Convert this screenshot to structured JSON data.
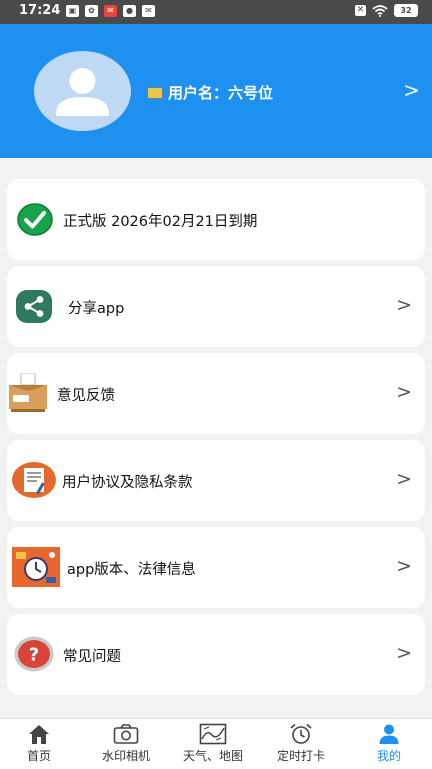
{
  "status_bar": {
    "time": "17:24",
    "battery": "32"
  },
  "profile": {
    "username_label": "用户名：六号位",
    "arrow": ">"
  },
  "menu": [
    {
      "label": "正式版 2026年02月21日到期",
      "icon": "check-circle-icon",
      "chevron": ""
    },
    {
      "label": "分享app",
      "icon": "share-icon",
      "chevron": ">"
    },
    {
      "label": "意见反馈",
      "icon": "feedback-box-icon",
      "chevron": ">"
    },
    {
      "label": "用户协议及隐私条款",
      "icon": "document-icon",
      "chevron": ">"
    },
    {
      "label": "app版本、法律信息",
      "icon": "clock-illustration-icon",
      "chevron": ">"
    },
    {
      "label": "常见问题",
      "icon": "question-icon",
      "chevron": ">"
    }
  ],
  "nav": [
    {
      "label": "首页",
      "icon": "home-icon"
    },
    {
      "label": "水印相机",
      "icon": "camera-icon"
    },
    {
      "label": "天气、地图",
      "icon": "map-icon"
    },
    {
      "label": "定时打卡",
      "icon": "alarm-icon"
    },
    {
      "label": "我的",
      "icon": "person-icon",
      "active": true
    }
  ],
  "colors": {
    "header": "#1e90f0",
    "active_tab": "#1e90f0",
    "check_green": "#16a34a",
    "share_teal": "#2f7a5e",
    "question_red": "#d9443a"
  }
}
